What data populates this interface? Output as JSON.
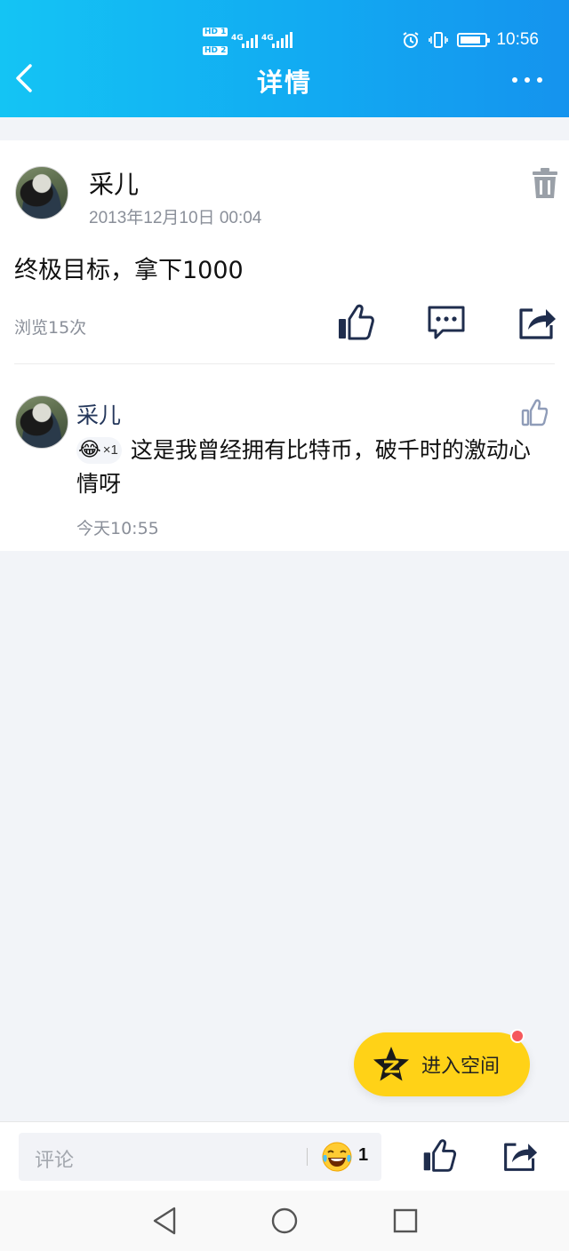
{
  "status_bar": {
    "sim1": "HD 1",
    "sim2": "HD 2",
    "net1": "4G",
    "net2": "4G",
    "time": "10:56",
    "icons": [
      "alarm-icon",
      "vibrate-icon",
      "battery-icon"
    ]
  },
  "header": {
    "title": "详情",
    "back_icon": "chevron-left-icon",
    "more_icon": "more-dots-icon"
  },
  "post": {
    "author": "采儿",
    "timestamp": "2013年12月10日 00:04",
    "content": "终极目标，拿下1000",
    "views": "浏览15次",
    "actions": [
      "like-icon",
      "comment-icon",
      "share-icon"
    ],
    "delete_icon": "trash-icon"
  },
  "comment": {
    "author": "采儿",
    "reaction_emoji": "😂",
    "reaction_count": "×1",
    "text": "这是我曾经拥有比特币，破千时的激动心情呀",
    "time": "今天10:55"
  },
  "floating_button": {
    "label": "进入空间",
    "icon": "qzone-star-icon",
    "badge_color": "#f5585c"
  },
  "bottom_bar": {
    "comment_placeholder": "评论",
    "reaction_count": "1",
    "icons": [
      "laugh-emoji-icon",
      "like-icon",
      "share-icon"
    ]
  },
  "nav_bar": {
    "icons": [
      "nav-back-icon",
      "nav-home-icon",
      "nav-recents-icon"
    ]
  },
  "colors": {
    "header_gradient_start": "#14c4f4",
    "header_gradient_end": "#1593ee",
    "author_link": "#24375b",
    "secondary_text": "#8a8f99",
    "floating_button": "#ffd217"
  }
}
